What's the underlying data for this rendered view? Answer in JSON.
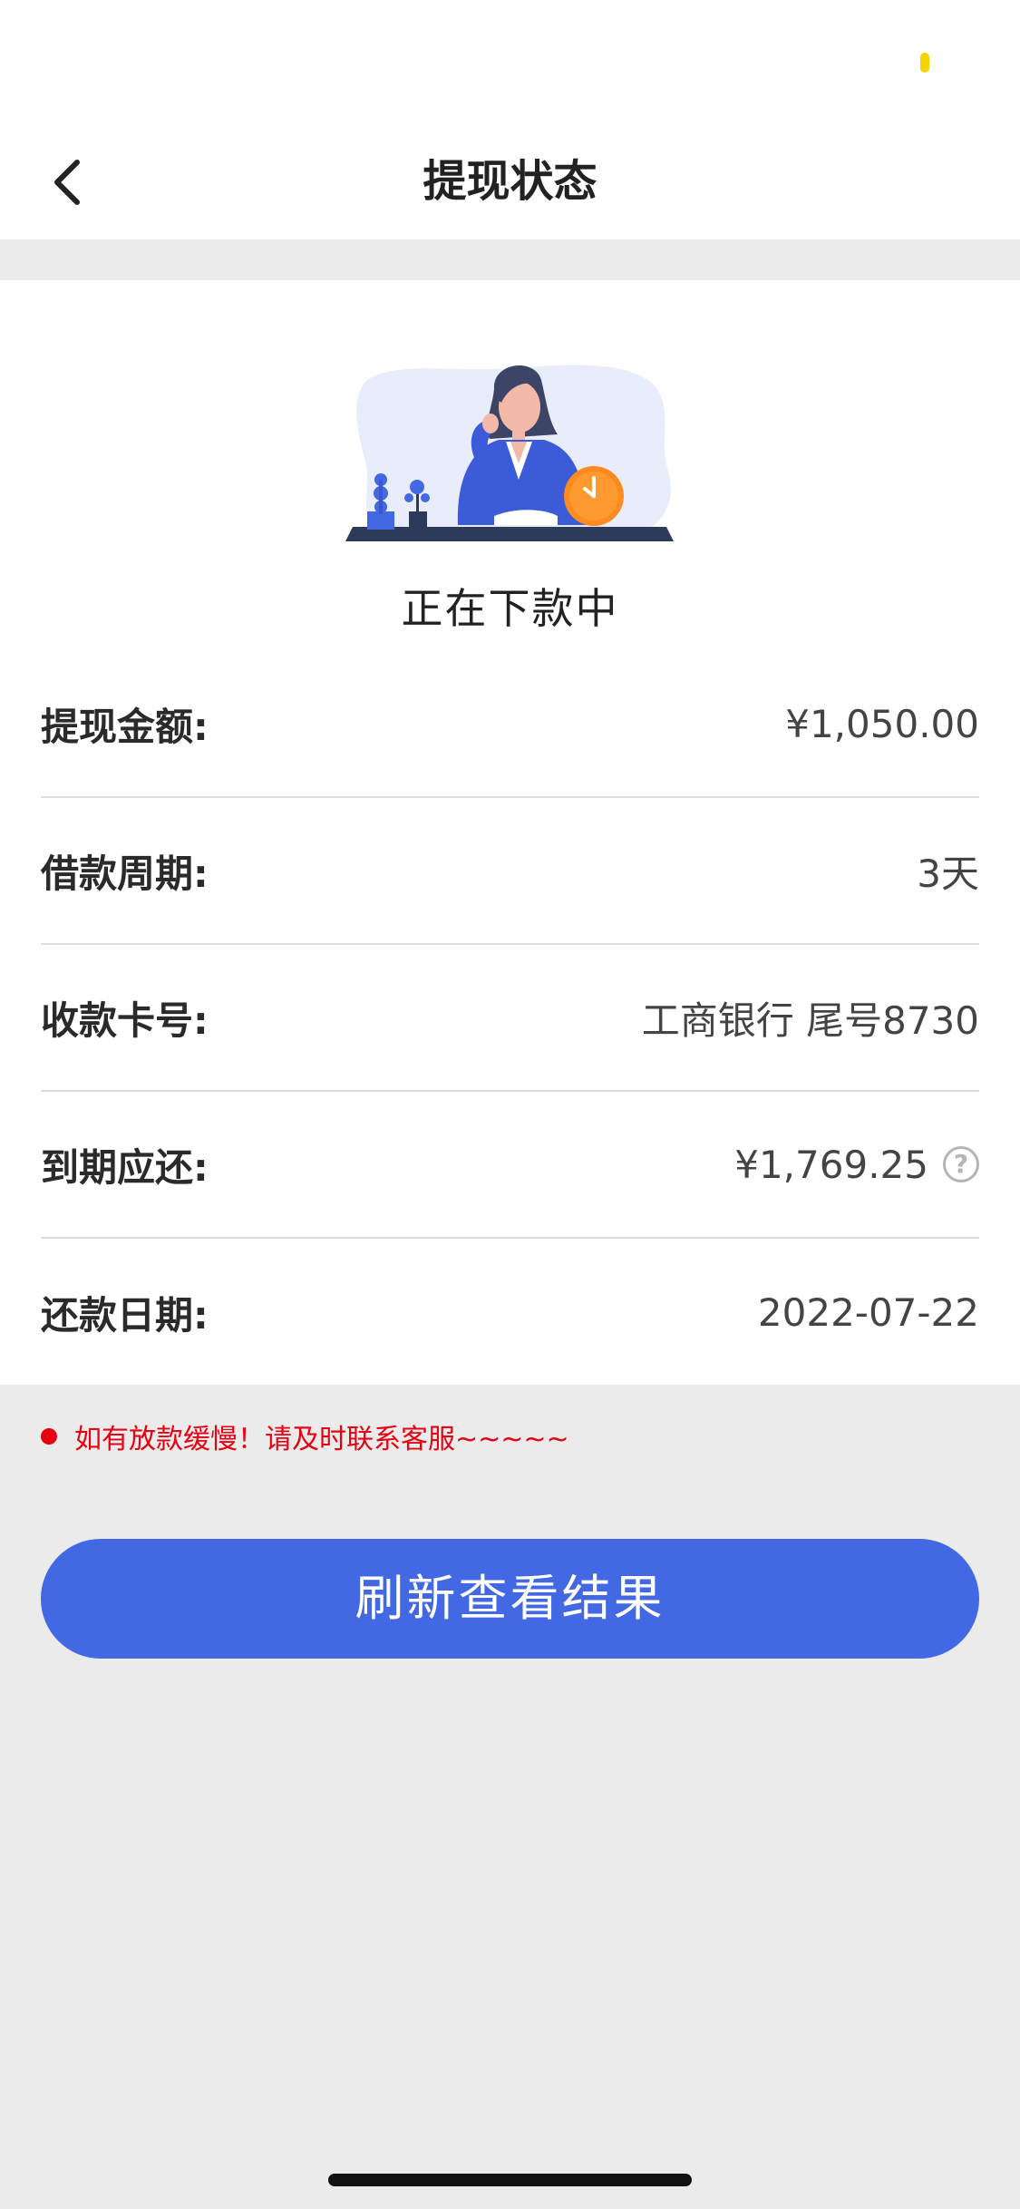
{
  "header": {
    "title": "提现状态",
    "back_icon": "chevron-left-icon"
  },
  "status": {
    "text": "正在下款中"
  },
  "details": [
    {
      "label": "提现金额:",
      "value": "¥1,050.00"
    },
    {
      "label": "借款周期:",
      "value": "3天"
    },
    {
      "label": "收款卡号:",
      "value": "工商银行 尾号8730"
    },
    {
      "label": "到期应还:",
      "value": "¥1,769.25",
      "help_icon": "question-circle-icon",
      "help_glyph": "?"
    },
    {
      "label": "还款日期:",
      "value": "2022-07-22"
    }
  ],
  "notice": {
    "text": "如有放款缓慢！请及时联系客服~~~~~",
    "color": "#e60012"
  },
  "refresh_button": {
    "label": "刷新查看结果",
    "color": "#4268e3"
  }
}
